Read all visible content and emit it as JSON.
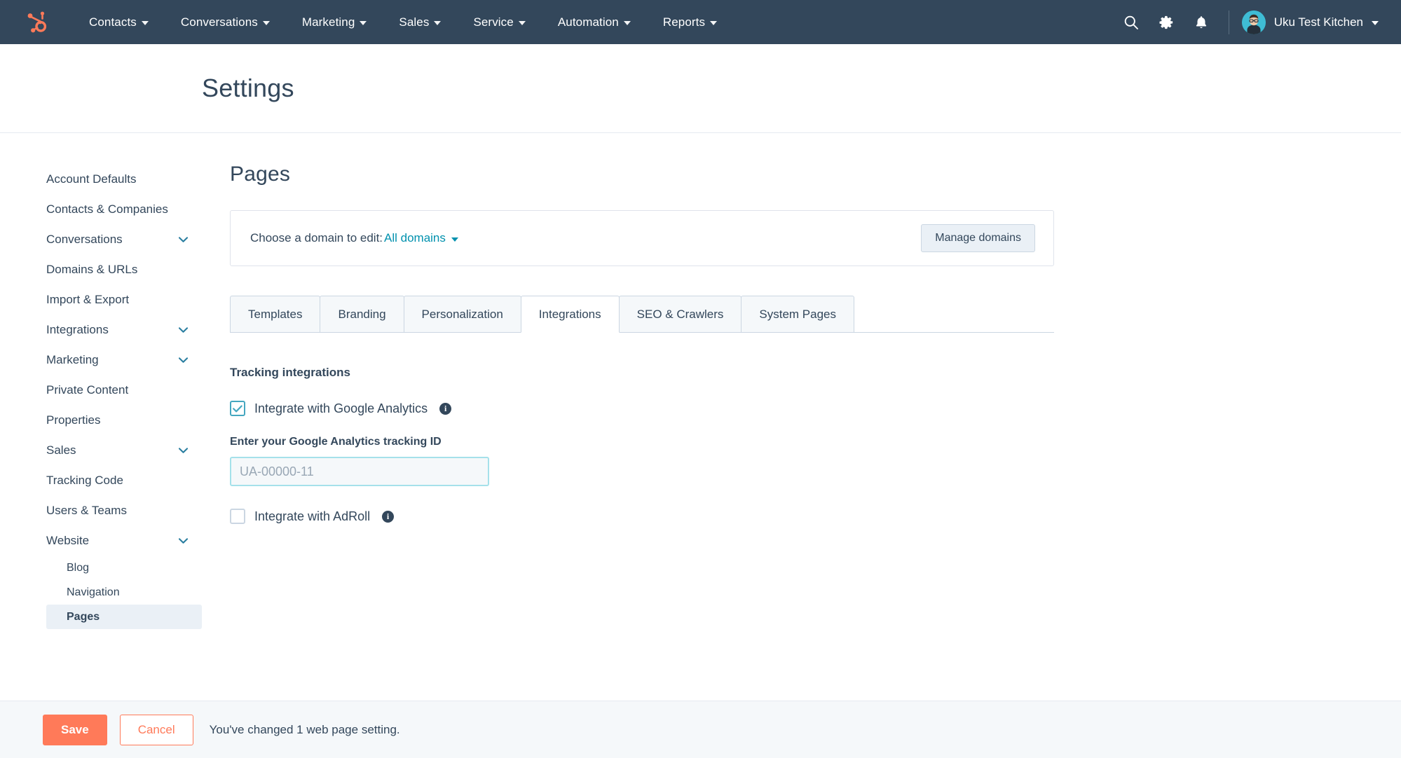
{
  "topnav": {
    "logo_icon": "hubspot-sprocket-logo",
    "brand_color": "#ff7a59",
    "background": "#33475b",
    "items": [
      {
        "label": "Contacts",
        "icon": "chevron-down-icon"
      },
      {
        "label": "Conversations",
        "icon": "chevron-down-icon"
      },
      {
        "label": "Marketing",
        "icon": "chevron-down-icon"
      },
      {
        "label": "Sales",
        "icon": "chevron-down-icon"
      },
      {
        "label": "Service",
        "icon": "chevron-down-icon"
      },
      {
        "label": "Automation",
        "icon": "chevron-down-icon"
      },
      {
        "label": "Reports",
        "icon": "chevron-down-icon"
      }
    ],
    "actions": [
      {
        "icon": "search-icon"
      },
      {
        "icon": "gear-icon"
      },
      {
        "icon": "bell-icon"
      }
    ],
    "account": {
      "name": "Uku Test Kitchen",
      "avatar_icon": "user-avatar",
      "caret_icon": "chevron-down-icon"
    }
  },
  "header": {
    "title": "Settings"
  },
  "sidebar": {
    "items": [
      {
        "label": "Account Defaults",
        "expandable": false,
        "active": false,
        "sub": false
      },
      {
        "label": "Contacts & Companies",
        "expandable": false,
        "active": false,
        "sub": false
      },
      {
        "label": "Conversations",
        "expandable": true,
        "active": false,
        "sub": false
      },
      {
        "label": "Domains & URLs",
        "expandable": false,
        "active": false,
        "sub": false
      },
      {
        "label": "Import & Export",
        "expandable": false,
        "active": false,
        "sub": false
      },
      {
        "label": "Integrations",
        "expandable": true,
        "active": false,
        "sub": false
      },
      {
        "label": "Marketing",
        "expandable": true,
        "active": false,
        "sub": false
      },
      {
        "label": "Private Content",
        "expandable": false,
        "active": false,
        "sub": false
      },
      {
        "label": "Properties",
        "expandable": false,
        "active": false,
        "sub": false
      },
      {
        "label": "Sales",
        "expandable": true,
        "active": false,
        "sub": false
      },
      {
        "label": "Tracking Code",
        "expandable": false,
        "active": false,
        "sub": false
      },
      {
        "label": "Users & Teams",
        "expandable": false,
        "active": false,
        "sub": false
      },
      {
        "label": "Website",
        "expandable": true,
        "active": false,
        "sub": false
      },
      {
        "label": "Blog",
        "expandable": false,
        "active": false,
        "sub": true
      },
      {
        "label": "Navigation",
        "expandable": false,
        "active": false,
        "sub": true
      },
      {
        "label": "Pages",
        "expandable": false,
        "active": true,
        "sub": true
      }
    ],
    "chevron_color": "#2a7ea0"
  },
  "main": {
    "page_title": "Pages",
    "domain_card": {
      "label": "Choose a domain to edit:",
      "selected_domain": "All domains",
      "caret_icon": "chevron-down-icon",
      "manage_button": "Manage domains",
      "link_color": "#0091ae"
    },
    "tabs": [
      {
        "label": "Templates",
        "active": false
      },
      {
        "label": "Branding",
        "active": false
      },
      {
        "label": "Personalization",
        "active": false
      },
      {
        "label": "Integrations",
        "active": true
      },
      {
        "label": "SEO & Crawlers",
        "active": false
      },
      {
        "label": "System Pages",
        "active": false
      }
    ],
    "section": {
      "title": "Tracking integrations",
      "google_analytics": {
        "checkbox_label": "Integrate with Google Analytics",
        "checked": true,
        "info_icon": "info-icon",
        "field_label": "Enter your Google Analytics tracking ID",
        "input_value": "",
        "input_placeholder": "UA-00000-11",
        "input_focus_color": "#a5e1ea"
      },
      "adroll": {
        "checkbox_label": "Integrate with AdRoll",
        "checked": false,
        "info_icon": "info-icon"
      }
    }
  },
  "savebar": {
    "save_label": "Save",
    "cancel_label": "Cancel",
    "message": "You've changed 1 web page setting.",
    "save_color": "#ff7a59"
  }
}
